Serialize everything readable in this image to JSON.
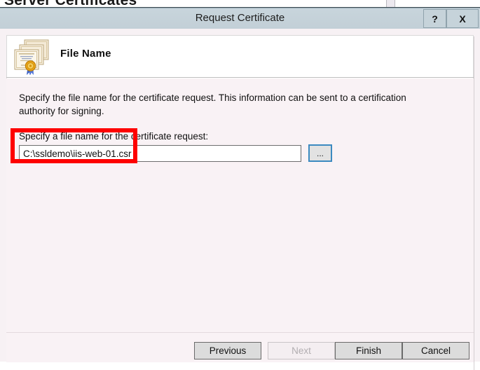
{
  "background_window": {
    "heading": "Server Certificates"
  },
  "dialog": {
    "title": "Request Certificate",
    "title_buttons": {
      "help_label": "?",
      "close_label": "X"
    },
    "header": {
      "icon": "certificate-stack-icon",
      "title": "File Name"
    },
    "body": {
      "intro_text": "Specify the file name for the certificate request. This information can be sent to a certification authority for signing.",
      "field_label": "Specify a file name for the certificate request:",
      "filename_value": "C:\\ssldemo\\iis-web-01.csr",
      "filename_placeholder": "",
      "browse_label": "..."
    },
    "footer": {
      "buttons": [
        {
          "label": "Previous",
          "enabled": true
        },
        {
          "label": "Next",
          "enabled": false
        },
        {
          "label": "Finish",
          "enabled": true
        },
        {
          "label": "Cancel",
          "enabled": true
        }
      ]
    }
  },
  "annotation": {
    "type": "highlight-rectangle",
    "color": "#fe0000",
    "target": "filename-input"
  },
  "colors": {
    "titlebar": "#c6d3da",
    "dialog_body": "#f9f2f5",
    "focus_border": "#3c8ac0",
    "annotation_red": "#fe0000"
  }
}
